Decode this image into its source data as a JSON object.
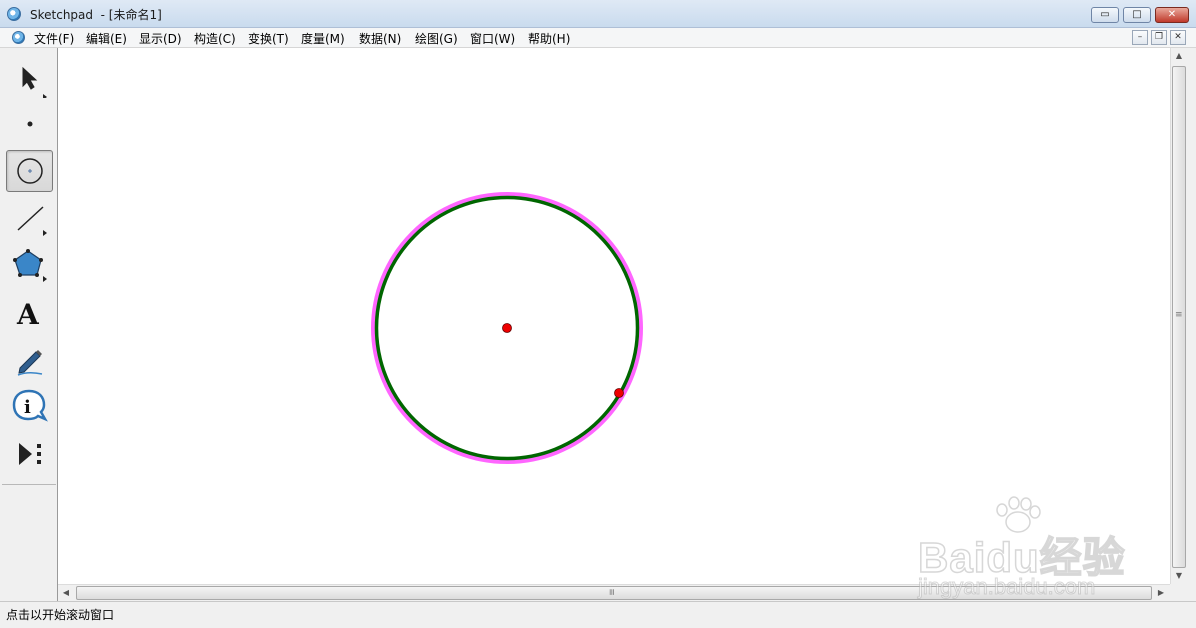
{
  "window": {
    "title": "Sketchpad  - [未命名1]",
    "minimize_label": "▭",
    "maximize_label": "□",
    "close_label": "✕"
  },
  "menubar": {
    "items": [
      {
        "label": "文件(F)"
      },
      {
        "label": "编辑(E)"
      },
      {
        "label": "显示(D)"
      },
      {
        "label": "构造(C)"
      },
      {
        "label": "变换(T)"
      },
      {
        "label": "度量(M)"
      },
      {
        "label": "数据(N)"
      },
      {
        "label": "绘图(G)"
      },
      {
        "label": "窗口(W)"
      },
      {
        "label": "帮助(H)"
      }
    ],
    "mdi_minimize": "–",
    "mdi_restore": "❐",
    "mdi_close": "✕"
  },
  "toolbox": {
    "tools": [
      {
        "name": "selection-arrow-tool",
        "icon": "arrow-icon"
      },
      {
        "name": "point-tool",
        "icon": "point-icon"
      },
      {
        "name": "compass-tool",
        "icon": "circle-icon",
        "selected": true
      },
      {
        "name": "straightedge-tool",
        "icon": "segment-icon"
      },
      {
        "name": "polygon-tool",
        "icon": "pentagon-icon"
      },
      {
        "name": "text-tool",
        "icon": "text-a-icon",
        "glyph": "A"
      },
      {
        "name": "marker-tool",
        "icon": "pen-icon"
      },
      {
        "name": "information-tool",
        "icon": "info-icon",
        "glyph": "i"
      },
      {
        "name": "custom-tool",
        "icon": "custom-tools-icon"
      }
    ]
  },
  "canvas": {
    "objects": [
      "circle",
      "center-point",
      "radius-point"
    ],
    "colors": {
      "circle_stroke": "#006600",
      "selection_highlight": "#ff66ff",
      "point_fill": "#ee0000"
    }
  },
  "scrollbars": {
    "grip": "≡",
    "up": "▲",
    "down": "▼",
    "left": "◀",
    "right": "▶"
  },
  "statusbar": {
    "text": "点击以开始滚动窗口"
  },
  "watermark": {
    "brand": "Baidu经验",
    "url": "jingyan.baidu.com"
  }
}
